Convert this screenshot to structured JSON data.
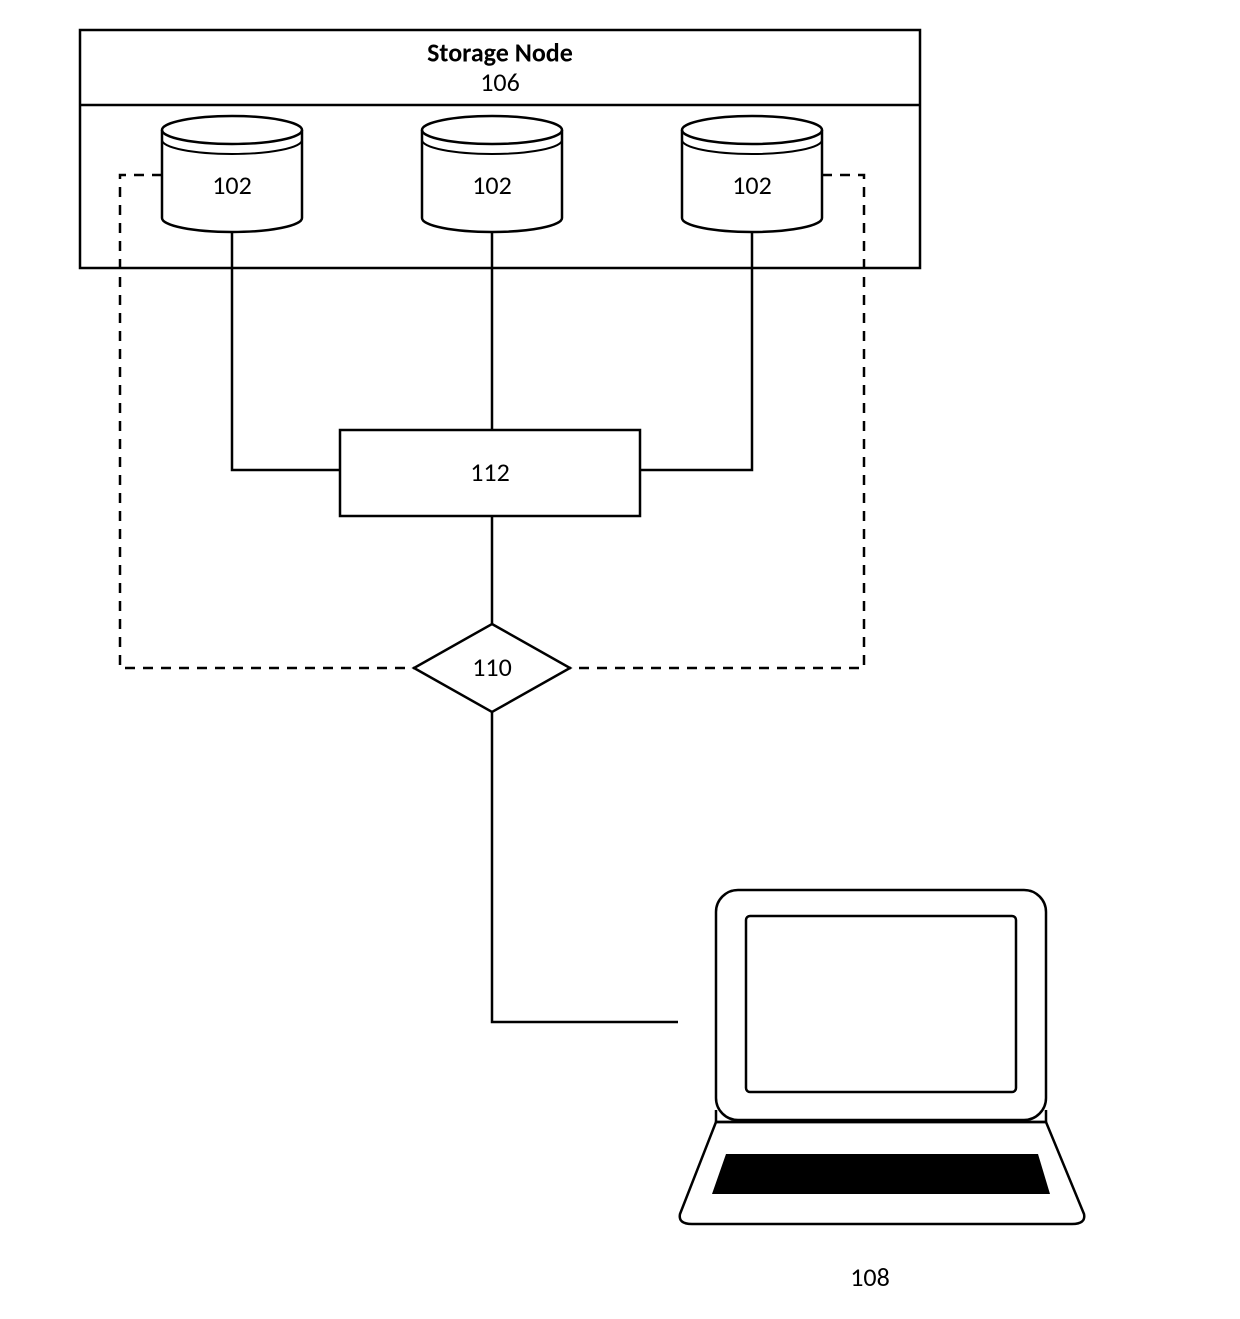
{
  "storage_node": {
    "title": "Storage Node",
    "ref": "106"
  },
  "cylinders": [
    "102",
    "102",
    "102"
  ],
  "process_box": "112",
  "decision": "110",
  "computer_ref": "108"
}
